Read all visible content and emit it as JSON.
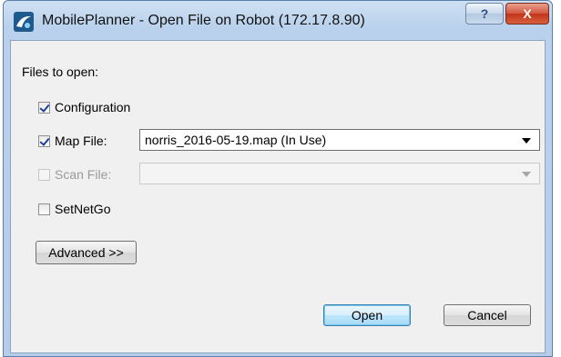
{
  "window": {
    "title": "MobilePlanner - Open File on Robot (172.17.8.90)",
    "help_label": "?",
    "close_label": "X"
  },
  "dialog": {
    "section_label": "Files to open:",
    "configuration": {
      "label": "Configuration",
      "checked": true
    },
    "map_file": {
      "label": "Map File:",
      "checked": true,
      "value": "norris_2016-05-19.map  (In Use)"
    },
    "scan_file": {
      "label": "Scan File:",
      "checked": false,
      "enabled": false,
      "value": ""
    },
    "setnetgo": {
      "label": "SetNetGo",
      "checked": false
    },
    "advanced_label": "Advanced >>",
    "open_label": "Open",
    "cancel_label": "Cancel"
  }
}
